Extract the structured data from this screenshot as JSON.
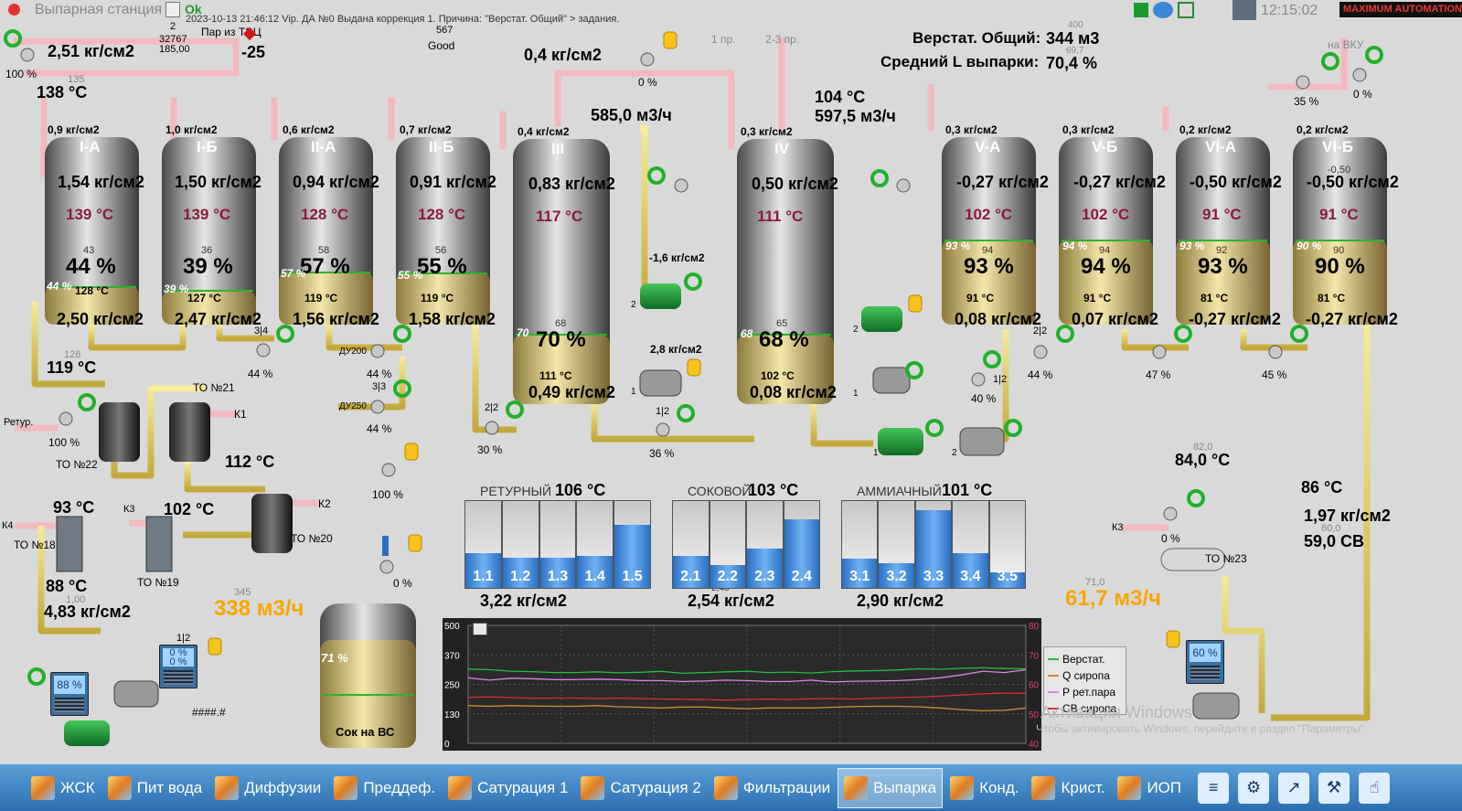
{
  "window": {
    "title": "Выпарная станция",
    "status_ok": "Ok",
    "log_message": "2023-10-13 21:46:12 Vip. ДА №0 Выдана коррекция 1.  Причина: \"Верстат. Общий\" > задания.",
    "time": "12:15:02",
    "brand": "MAXIMUM AUTOMATION"
  },
  "header_left": {
    "num2": "2",
    "num32767": "32767",
    "num185": "185,00",
    "steam_label": "Пар из ТЭЦ",
    "steam_value": "-25",
    "num567": "567",
    "good": "Good",
    "pressure": "2,51 кг/см2",
    "valve_pct": "100 %",
    "n135": "135",
    "temp": "138 °C",
    "mid_pressure": "0,4 кг/см2",
    "mid_valve": "0 %",
    "pr1": "1 пр.",
    "pr23": "2-3 пр.",
    "n400": "400",
    "n697": "69,7"
  },
  "summary": {
    "verstat_label": "Верстат. Общий:",
    "verstat_value": "344 м3",
    "mean_label": "Средний L выпарки:",
    "mean_value": "70,4 %",
    "vku_label": "на ВКУ",
    "vku_valve1": "0 %",
    "vku_valve2": "35 %"
  },
  "bodies": [
    {
      "name": "I-А",
      "top_p": "0,9 кг/см2",
      "p": "1,54 кг/см2",
      "t": "139 °C",
      "lvl_sp": "43",
      "lvl": "44 %",
      "lvl_small": "44 %",
      "t_low": "128 °C",
      "bottom_p": "2,50 кг/см2"
    },
    {
      "name": "I-Б",
      "top_p": "1,0 кг/см2",
      "p": "1,50 кг/см2",
      "t": "139 °C",
      "lvl_sp": "36",
      "lvl": "39 %",
      "lvl_small": "39 %",
      "t_low": "127 °C",
      "bottom_p": "2,47 кг/см2"
    },
    {
      "name": "II-А",
      "top_p": "0,6 кг/см2",
      "p": "0,94 кг/см2",
      "t": "128 °C",
      "lvl_sp": "58",
      "lvl": "57 %",
      "lvl_small": "57 %",
      "t_low": "119 °C",
      "bottom_p": "1,56 кг/см2"
    },
    {
      "name": "II-Б",
      "top_p": "0,7 кг/см2",
      "p": "0,91 кг/см2",
      "t": "128 °C",
      "lvl_sp": "56",
      "lvl": "55 %",
      "lvl_small": "55 %",
      "t_low": "119 °C",
      "bottom_p": "1,58 кг/см2"
    },
    {
      "name": "III",
      "top_p": "0,4 кг/см2",
      "p": "0,83 кг/см2",
      "t": "117 °C",
      "lvl_sp": "68",
      "lvl": "70 %",
      "lvl_small": "70",
      "t_low": "111 °C",
      "bottom_p": "0,49 кг/см2"
    },
    {
      "name": "IV",
      "top_p": "0,3 кг/см2",
      "p": "0,50 кг/см2",
      "t": "111 °C",
      "lvl_sp": "65",
      "lvl": "68 %",
      "lvl_small": "68",
      "t_low": "102 °C",
      "bottom_p": "0,08 кг/см2"
    },
    {
      "name": "V-А",
      "top_p": "0,3 кг/см2",
      "p": "-0,27 кг/см2",
      "t": "102 °C",
      "lvl_sp": "94",
      "lvl": "93 %",
      "lvl_small": "93 %",
      "t_low": "91 °C",
      "bottom_p": "0,08 кг/см2"
    },
    {
      "name": "V-Б",
      "top_p": "0,3 кг/см2",
      "p": "-0,27 кг/см2",
      "t": "102 °C",
      "lvl_sp": "94",
      "lvl": "94 %",
      "lvl_small": "94 %",
      "t_low": "91 °C",
      "bottom_p": "0,07 кг/см2"
    },
    {
      "name": "VI-А",
      "top_p": "0,2 кг/см2",
      "p": "-0,50 кг/см2",
      "t": "91 °C",
      "lvl_sp": "92",
      "lvl": "93 %",
      "lvl_small": "93 %",
      "t_low": "81 °C",
      "bottom_p": "-0,27 кг/см2"
    },
    {
      "name": "VI-Б",
      "top_p": "0,2 кг/см2",
      "p": "-0,50 кг/см2",
      "t": "91 °C",
      "lvl_sp": "90",
      "lvl": "90 %",
      "lvl_small": "90 %",
      "t_low": "81 °C",
      "bottom_p": "-0,27 кг/см2",
      "extra": "-0,50"
    }
  ],
  "flows": {
    "f3": "585,0 м3/ч",
    "t4": "104 °C",
    "f4": "597,5 м3/ч",
    "p_pump3": "-1,6 кг/см2",
    "p_pump3b": "2,8 кг/см2",
    "n2a": "2",
    "n1a": "1",
    "n2b": "2",
    "n1b": "1",
    "n1c": "1",
    "n2c": "2",
    "v12a": "1|2",
    "v36": "36 %",
    "v40": "40 %",
    "v12b": "1|2",
    "v30": "30 %",
    "v22a": "2|2",
    "v22b": "2|2"
  },
  "lower_valves": {
    "v44a": "44 %",
    "v34": "3|4",
    "du200": "ДУ200",
    "v44b": "44 %",
    "v33": "3|3",
    "du250": "ДУ250",
    "v44c": "44 %",
    "v100b": "100 %",
    "v44d": "44 %",
    "v47": "47 %",
    "v45": "45 %"
  },
  "heat_exchangers": {
    "retur": "Ретур.",
    "v100": "100 %",
    "n128": "128",
    "t119": "119 °C",
    "to22": "ТО №22",
    "to21": "ТО №21",
    "k1": "К1",
    "t112": "112 °C",
    "to20": "ТО №20",
    "k2": "К2",
    "t93": "93 °C",
    "k3a": "К3",
    "t102": "102 °C",
    "k4": "К4",
    "to18": "ТО №18",
    "to19": "ТО №19",
    "t88": "88 °C",
    "n100": "1,00",
    "p483": "4,83 кг/см2",
    "flow338": "338 м3/ч",
    "n345": "345"
  },
  "right_block": {
    "n820": "82,0",
    "t84": "84,0 °C",
    "k3": "К3",
    "v0": "0 %",
    "to23": "ТО №23",
    "t86": "86 °C",
    "p197": "1,97 кг/см2",
    "n600": "60,0",
    "sv": "59,0 СВ",
    "n710": "71,0",
    "flow617": "61,7 м3/ч",
    "rec_pct": "60 %"
  },
  "tank": {
    "label": "Сок на ВС",
    "level": "71 %",
    "valve": "0 %"
  },
  "recorders": {
    "left_pct": "88 %",
    "mid_line1": "0 %",
    "mid_line2": "0 %",
    "mid_label": "1|2",
    "hash": "####.#"
  },
  "gauge_groups": [
    {
      "title": "РЕТУРНЫЙ",
      "temp": "106 °C",
      "pressure": "3,22 кг/см2",
      "extra": "",
      "bars": [
        {
          "label": "1.1",
          "level": 0.4
        },
        {
          "label": "1.2",
          "level": 0.35
        },
        {
          "label": "1.3",
          "level": 0.35
        },
        {
          "label": "1.4",
          "level": 0.37
        },
        {
          "label": "1.5",
          "level": 0.73
        }
      ]
    },
    {
      "title": "СОКОВОЙ",
      "temp": "103 °C",
      "pressure": "2,54 кг/см2",
      "extra": "2,48",
      "bars": [
        {
          "label": "2.1",
          "level": 0.37
        },
        {
          "label": "2.2",
          "level": 0.26
        },
        {
          "label": "2.3",
          "level": 0.45
        },
        {
          "label": "2.4",
          "level": 0.79
        }
      ]
    },
    {
      "title": "АММИАЧНЫЙ",
      "temp": "101 °C",
      "pressure": "2,90 кг/см2",
      "extra": "",
      "bars": [
        {
          "label": "3.1",
          "level": 0.34
        },
        {
          "label": "3.2",
          "level": 0.28
        },
        {
          "label": "3.3",
          "level": 0.89
        },
        {
          "label": "3.4",
          "level": 0.4
        },
        {
          "label": "3.5",
          "level": 0.18
        }
      ]
    }
  ],
  "chart_data": {
    "type": "line",
    "left_ticks": [
      "500",
      "370",
      "250",
      "130",
      "0"
    ],
    "right_ticks_a": [
      "80",
      "70",
      "60",
      "50",
      "40"
    ],
    "right_ticks_b": [
      "4",
      "",
      "",
      "",
      "0"
    ],
    "series": [
      {
        "name": "Верстат.",
        "color": "#1fbf3a",
        "values": [
          315,
          312,
          306,
          304,
          300,
          300,
          303,
          299,
          301,
          305,
          297,
          300,
          303,
          306,
          300,
          302,
          298,
          304,
          307,
          308,
          311,
          316,
          314,
          318,
          320,
          317,
          316
        ]
      },
      {
        "name": "Q сиропа",
        "color": "#d48a2a",
        "values": [
          160,
          157,
          160,
          158,
          157,
          157,
          160,
          155,
          153,
          150,
          154,
          154,
          150,
          147,
          150,
          150,
          150,
          153,
          156,
          157,
          157,
          155,
          150,
          143,
          138,
          140,
          150
        ]
      },
      {
        "name": "P рет.пара",
        "color": "#d884e6",
        "values": [
          278,
          268,
          276,
          274,
          270,
          270,
          272,
          270,
          266,
          266,
          262,
          264,
          268,
          266,
          262,
          262,
          268,
          260,
          263,
          264,
          266,
          270,
          278,
          290,
          306,
          300,
          312
        ]
      },
      {
        "name": "СВ сиропа",
        "color": "#d93030",
        "values": [
          195,
          197,
          194,
          191,
          192,
          192,
          190,
          192,
          190,
          188,
          187,
          186,
          183,
          186,
          188,
          186,
          189,
          190,
          188,
          191,
          194,
          196,
          200,
          205,
          210,
          213,
          212
        ]
      }
    ],
    "ylim": [
      0,
      500
    ]
  },
  "watermark": {
    "line1": "Активация Windows",
    "line2": "Чтобы активировать Windows, перейдите в раздел \"Параметры\"."
  },
  "taskbar": [
    {
      "label": "ЖСК"
    },
    {
      "label": "Пит вода"
    },
    {
      "label": "Диффузии"
    },
    {
      "label": "Преддеф."
    },
    {
      "label": "Сатурация 1"
    },
    {
      "label": "Сатурация 2"
    },
    {
      "label": "Фильтрации"
    },
    {
      "label": "Выпарка",
      "active": true
    },
    {
      "label": "Конд."
    },
    {
      "label": "Крист."
    },
    {
      "label": "ИОП"
    }
  ]
}
